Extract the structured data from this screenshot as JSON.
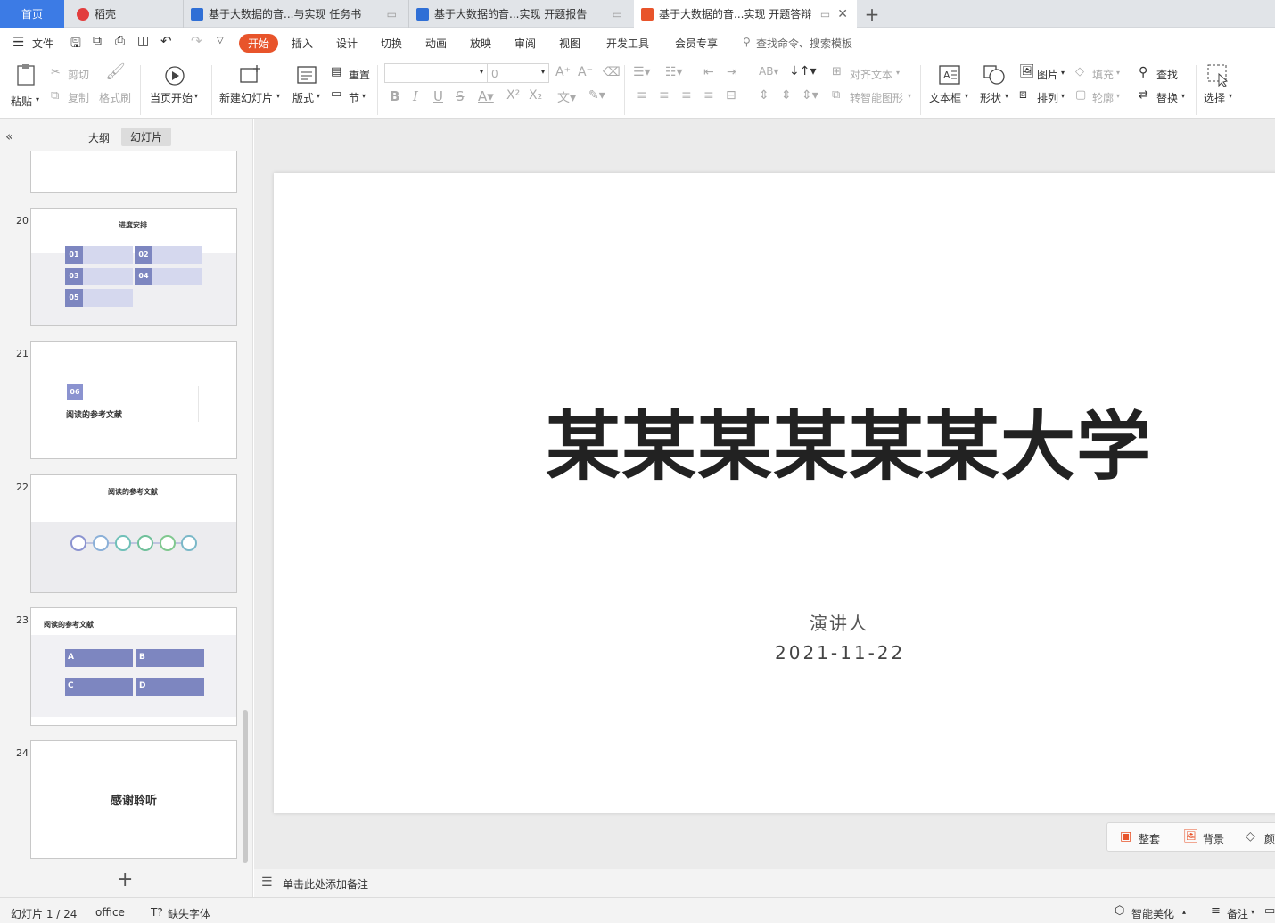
{
  "tabs": {
    "home": "首页",
    "daoke": "稻壳",
    "doc1": "基于大数据的音...与实现 任务书",
    "doc2": "基于大数据的音...实现 开题报告",
    "doc3": "基于大数据的音...实现 开题答辩",
    "new_tab": "+"
  },
  "menu": {
    "file": "文件",
    "start": "开始",
    "insert": "插入",
    "design": "设计",
    "switch": "切换",
    "animation": "动画",
    "slideshow": "放映",
    "review": "审阅",
    "view": "视图",
    "devtools": "开发工具",
    "member": "会员专享",
    "search": "查找命令、搜索模板"
  },
  "ribbon": {
    "paste": "粘贴",
    "cut": "剪切",
    "copy": "复制",
    "format_painter": "格式刷",
    "play_current": "当页开始",
    "new_slide": "新建幻灯片",
    "layout": "版式",
    "reset": "重置",
    "section": "节",
    "font_size": "0",
    "align_text": "对齐文本",
    "smart_shape": "转智能图形",
    "textbox": "文本框",
    "shape": "形状",
    "picture": "图片",
    "arrange": "排列",
    "fill": "填充",
    "outline": "轮廓",
    "find": "查找",
    "replace": "替换",
    "select": "选择"
  },
  "panel": {
    "outline_tab": "大纲",
    "slides_tab": "幻灯片"
  },
  "thumbs": {
    "s20": {
      "num": "20",
      "title": "进度安排",
      "b1": "01",
      "b2": "02",
      "b3": "03",
      "b4": "04",
      "b5": "05"
    },
    "s21": {
      "num": "21",
      "badge": "06",
      "title": "阅读的参考文献"
    },
    "s22": {
      "num": "22",
      "title": "阅读的参考文献"
    },
    "s23": {
      "num": "23",
      "title": "阅读的参考文献",
      "a": "A",
      "b": "B",
      "c": "C",
      "d": "D"
    },
    "s24": {
      "num": "24",
      "title": "感谢聆听"
    }
  },
  "slide": {
    "title": "某某某某某某大学",
    "presenter": "演讲人",
    "date": "2021-11-22"
  },
  "float_toolbar": {
    "whole_set": "整套",
    "background": "背景",
    "color": "颜"
  },
  "notes_placeholder": "单击此处添加备注",
  "status": {
    "slide_count": "幻灯片 1 / 24",
    "theme": "office",
    "missing_font": "缺失字体",
    "smart_beautify": "智能美化",
    "notes": "备注"
  },
  "colors": {
    "accent_orange": "#e8542b",
    "tab_active_blue": "#3c7be5",
    "thumb_purple": "#7d86c0"
  }
}
